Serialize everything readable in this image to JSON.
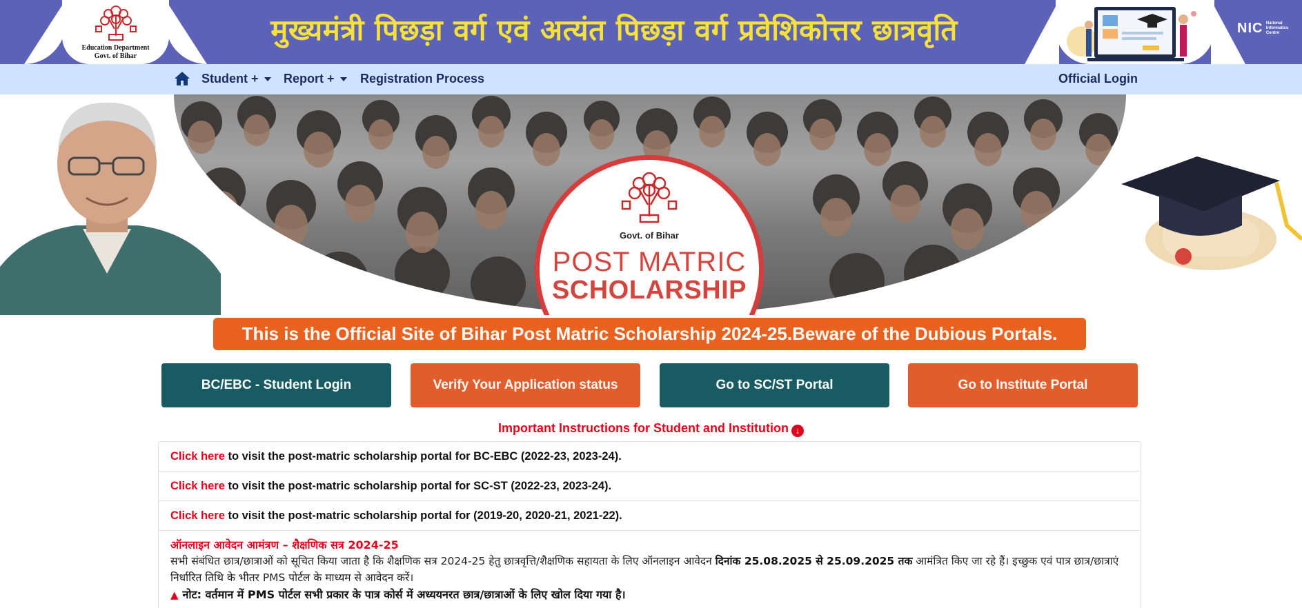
{
  "header": {
    "logo_caption_1": "Education Department",
    "logo_caption_2": "Govt. of Bihar",
    "title": "मुख्यमंत्री पिछड़ा वर्ग एवं अत्यंत पिछड़ा वर्ग प्रवेशिकोत्तर छात्रवृति",
    "nic_logo": "NIC",
    "nic_sub": "National Informatics Centre"
  },
  "nav": {
    "home_icon": "home-icon",
    "items": [
      {
        "label": "Student +"
      },
      {
        "label": "Report +"
      },
      {
        "label": "Registration Process"
      }
    ],
    "official_login": "Official Login"
  },
  "banner": {
    "seal_gov": "Govt. of Bihar",
    "seal_line1": "POST MATRIC",
    "seal_line2": "SCHOLARSHIP"
  },
  "notice": "This is the Official Site of Bihar Post Matric Scholarship 2024-25.Beware of the Dubious Portals.",
  "buttons": [
    {
      "label": "BC/EBC - Student Login"
    },
    {
      "label": "Verify Your Application status"
    },
    {
      "label": "Go to SC/ST Portal"
    },
    {
      "label": "Go to Institute Portal"
    }
  ],
  "instructions": {
    "heading": "Important Instructions for Student and Institution",
    "links": [
      {
        "link": "Click here",
        "text": " to visit the post-matric scholarship portal for BC-EBC (2022-23, 2023-24)."
      },
      {
        "link": "Click here",
        "text": " to visit the post-matric scholarship portal for SC-ST (2022-23, 2023-24)."
      },
      {
        "link": "Click here",
        "text": " to visit the post-matric scholarship portal for (2019-20, 2020-21, 2021-22)."
      }
    ],
    "hindi_title": "ऑनलाइन आवेदन आमंत्रण – शैक्षणिक सत्र 2024-25",
    "hindi_body_1": "सभी संबंधित छात्र/छात्राओं को सूचित किया जाता है कि शैक्षणिक सत्र 2024-25 हेतु छात्रवृत्ति/शैक्षणिक सहायता के लिए ऑनलाइन आवेदन ",
    "hindi_body_bold": "दिनांक 25.08.2025 से 25.09.2025 तक",
    "hindi_body_2": " आमंत्रित किए जा रहे हैं। इच्छुक एवं पात्र छात्र/छात्राएं निर्धारित तिथि के भीतर PMS पोर्टल के माध्यम से आवेदन करें।",
    "hindi_note": "नोट: वर्तमान में PMS पोर्टल सभी प्रकार के पात्र कोर्स में अध्ययनरत छात्र/छात्राओं के लिए खोल दिया गया है।"
  },
  "colors": {
    "header_bg": "#5b62b8",
    "header_title": "#f5e13a",
    "navbar_bg": "#cfe2ff",
    "notice_bg": "#e8611f",
    "teal": "#195b62",
    "orange": "#e15e2c",
    "link_red": "#e0061d"
  }
}
